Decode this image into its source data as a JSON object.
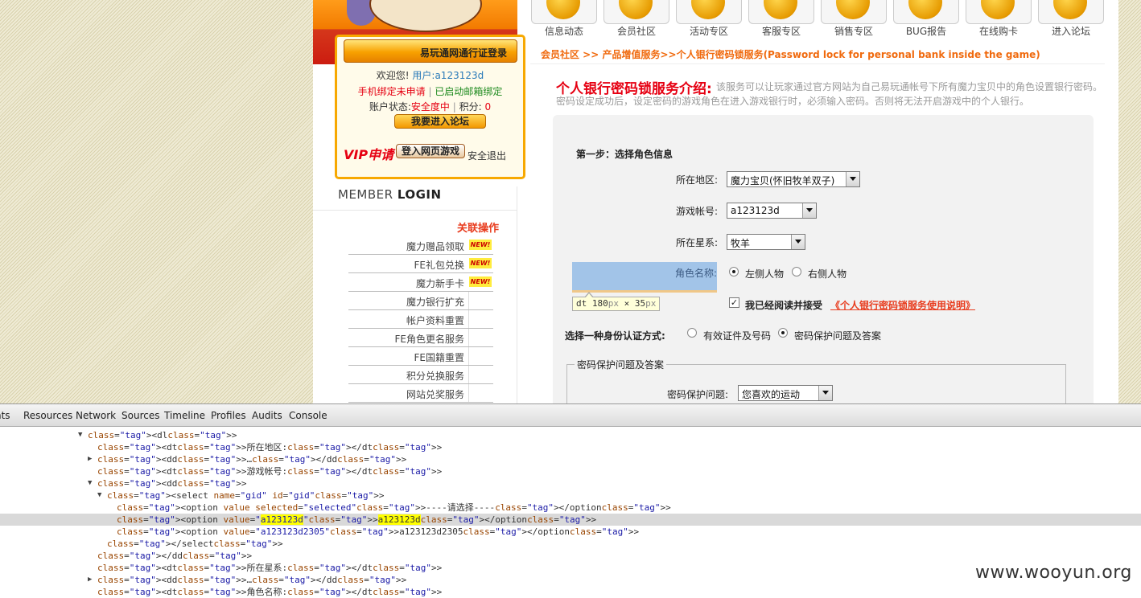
{
  "login": {
    "title": "易玩通网通行证登录",
    "welcome": "欢迎您!",
    "user_label": "用户:",
    "username": "a123123d",
    "phone_status": "手机绑定未申请",
    "email_status": "已启动邮箱绑定",
    "account_status_label": "账户状态:",
    "account_status": "安全度中",
    "points_label": "积分:",
    "points": "0",
    "forum_button": "我要进入论坛",
    "web_game_button": "登入网页游戏",
    "logout": "安全退出",
    "vip": "VIP申请",
    "member_login_a": "MEMBER",
    "member_login_b": "LOGIN"
  },
  "sidebar": {
    "title": "关联操作",
    "items": [
      {
        "label": "魔力赠品领取",
        "badge": "NEW!"
      },
      {
        "label": "FE礼包兑换",
        "badge": "NEW!"
      },
      {
        "label": "魔力新手卡",
        "badge": "NEW!"
      },
      {
        "label": "魔力银行扩充",
        "badge": ""
      },
      {
        "label": "帐户资料重置",
        "badge": ""
      },
      {
        "label": "FE角色更名服务",
        "badge": ""
      },
      {
        "label": "FE国籍重置",
        "badge": ""
      },
      {
        "label": "积分兑换服务",
        "badge": ""
      },
      {
        "label": "网站兑奖服务",
        "badge": ""
      }
    ]
  },
  "nav": {
    "items": [
      {
        "label": "信息动态",
        "icon": "news-icon"
      },
      {
        "label": "会员社区",
        "icon": "community-icon"
      },
      {
        "label": "活动专区",
        "icon": "activity-icon"
      },
      {
        "label": "客服专区",
        "icon": "service-icon"
      },
      {
        "label": "销售专区",
        "icon": "sales-icon"
      },
      {
        "label": "BUG报告",
        "icon": "bug-icon"
      },
      {
        "label": "在线购卡",
        "icon": "card-icon"
      },
      {
        "label": "进入论坛",
        "icon": "forum-icon"
      }
    ]
  },
  "breadcrumb": "会员社区 >> 产品增值服务>>个人银行密码锁服务(Password lock for personal bank inside the game)",
  "intro": {
    "title": "个人银行密码锁服务介绍:",
    "text": "该服务可以让玩家通过官方网站为自己易玩通帐号下所有魔力宝贝中的角色设置银行密码。密码设定成功后，设定密码的游戏角色在进入游戏银行时，必须输入密码。否则将无法开启游戏中的个人银行。"
  },
  "form": {
    "step1": "第一步：选择角色信息",
    "region_label": "所在地区:",
    "region_value": "魔力宝贝(怀旧牧羊双子)",
    "account_label": "游戏帐号:",
    "account_value": "a123123d",
    "star_label": "所在星系:",
    "star_value": "牧羊",
    "role_label": "角色名称:",
    "role_left": "左侧人物",
    "role_right": "右侧人物",
    "agree_text": "我已经阅读并接受",
    "agree_link": "《个人银行密码锁服务使用说明》",
    "auth_label": "选择一种身份认证方式:",
    "auth_opt1": "有效证件及号码",
    "auth_opt2": "密码保护问题及答案",
    "fieldset_legend": "密码保护问题及答案",
    "question_label": "密码保护问题:",
    "question_value": "您喜欢的运动"
  },
  "inspector_tip": {
    "tag": "dt",
    "width": "180",
    "height": "35",
    "unit": "px",
    "times": "×"
  },
  "devtools": {
    "tabs": [
      "nts",
      "Resources",
      "Network",
      "Sources",
      "Timeline",
      "Profiles",
      "Audits",
      "Console"
    ],
    "lines": [
      "<dl>",
      "<dt>所在地区:</dt>",
      "<dd>…</dd>",
      "<dt>游戏帐号:</dt>",
      "<dd>",
      "<select name=\"gid\" id=\"gid\">",
      "<option value selected=\"selected\">----请选择----</option>",
      "<option value=\"a123123d\">a123123d</option>",
      "<option value=\"a123123d2305\">a123123d2305</option>",
      "</select>",
      "</dd>",
      "<dt>所在星系:</dt>",
      "<dd>…</dd>",
      "<dt>角色名称:</dt>"
    ]
  },
  "watermark": "www.wooyun.org",
  "colors": {
    "accent": "#f06a0e",
    "title_red": "#e60012",
    "link_red": "#e83c1e",
    "highlight": "#a2c4e8"
  }
}
